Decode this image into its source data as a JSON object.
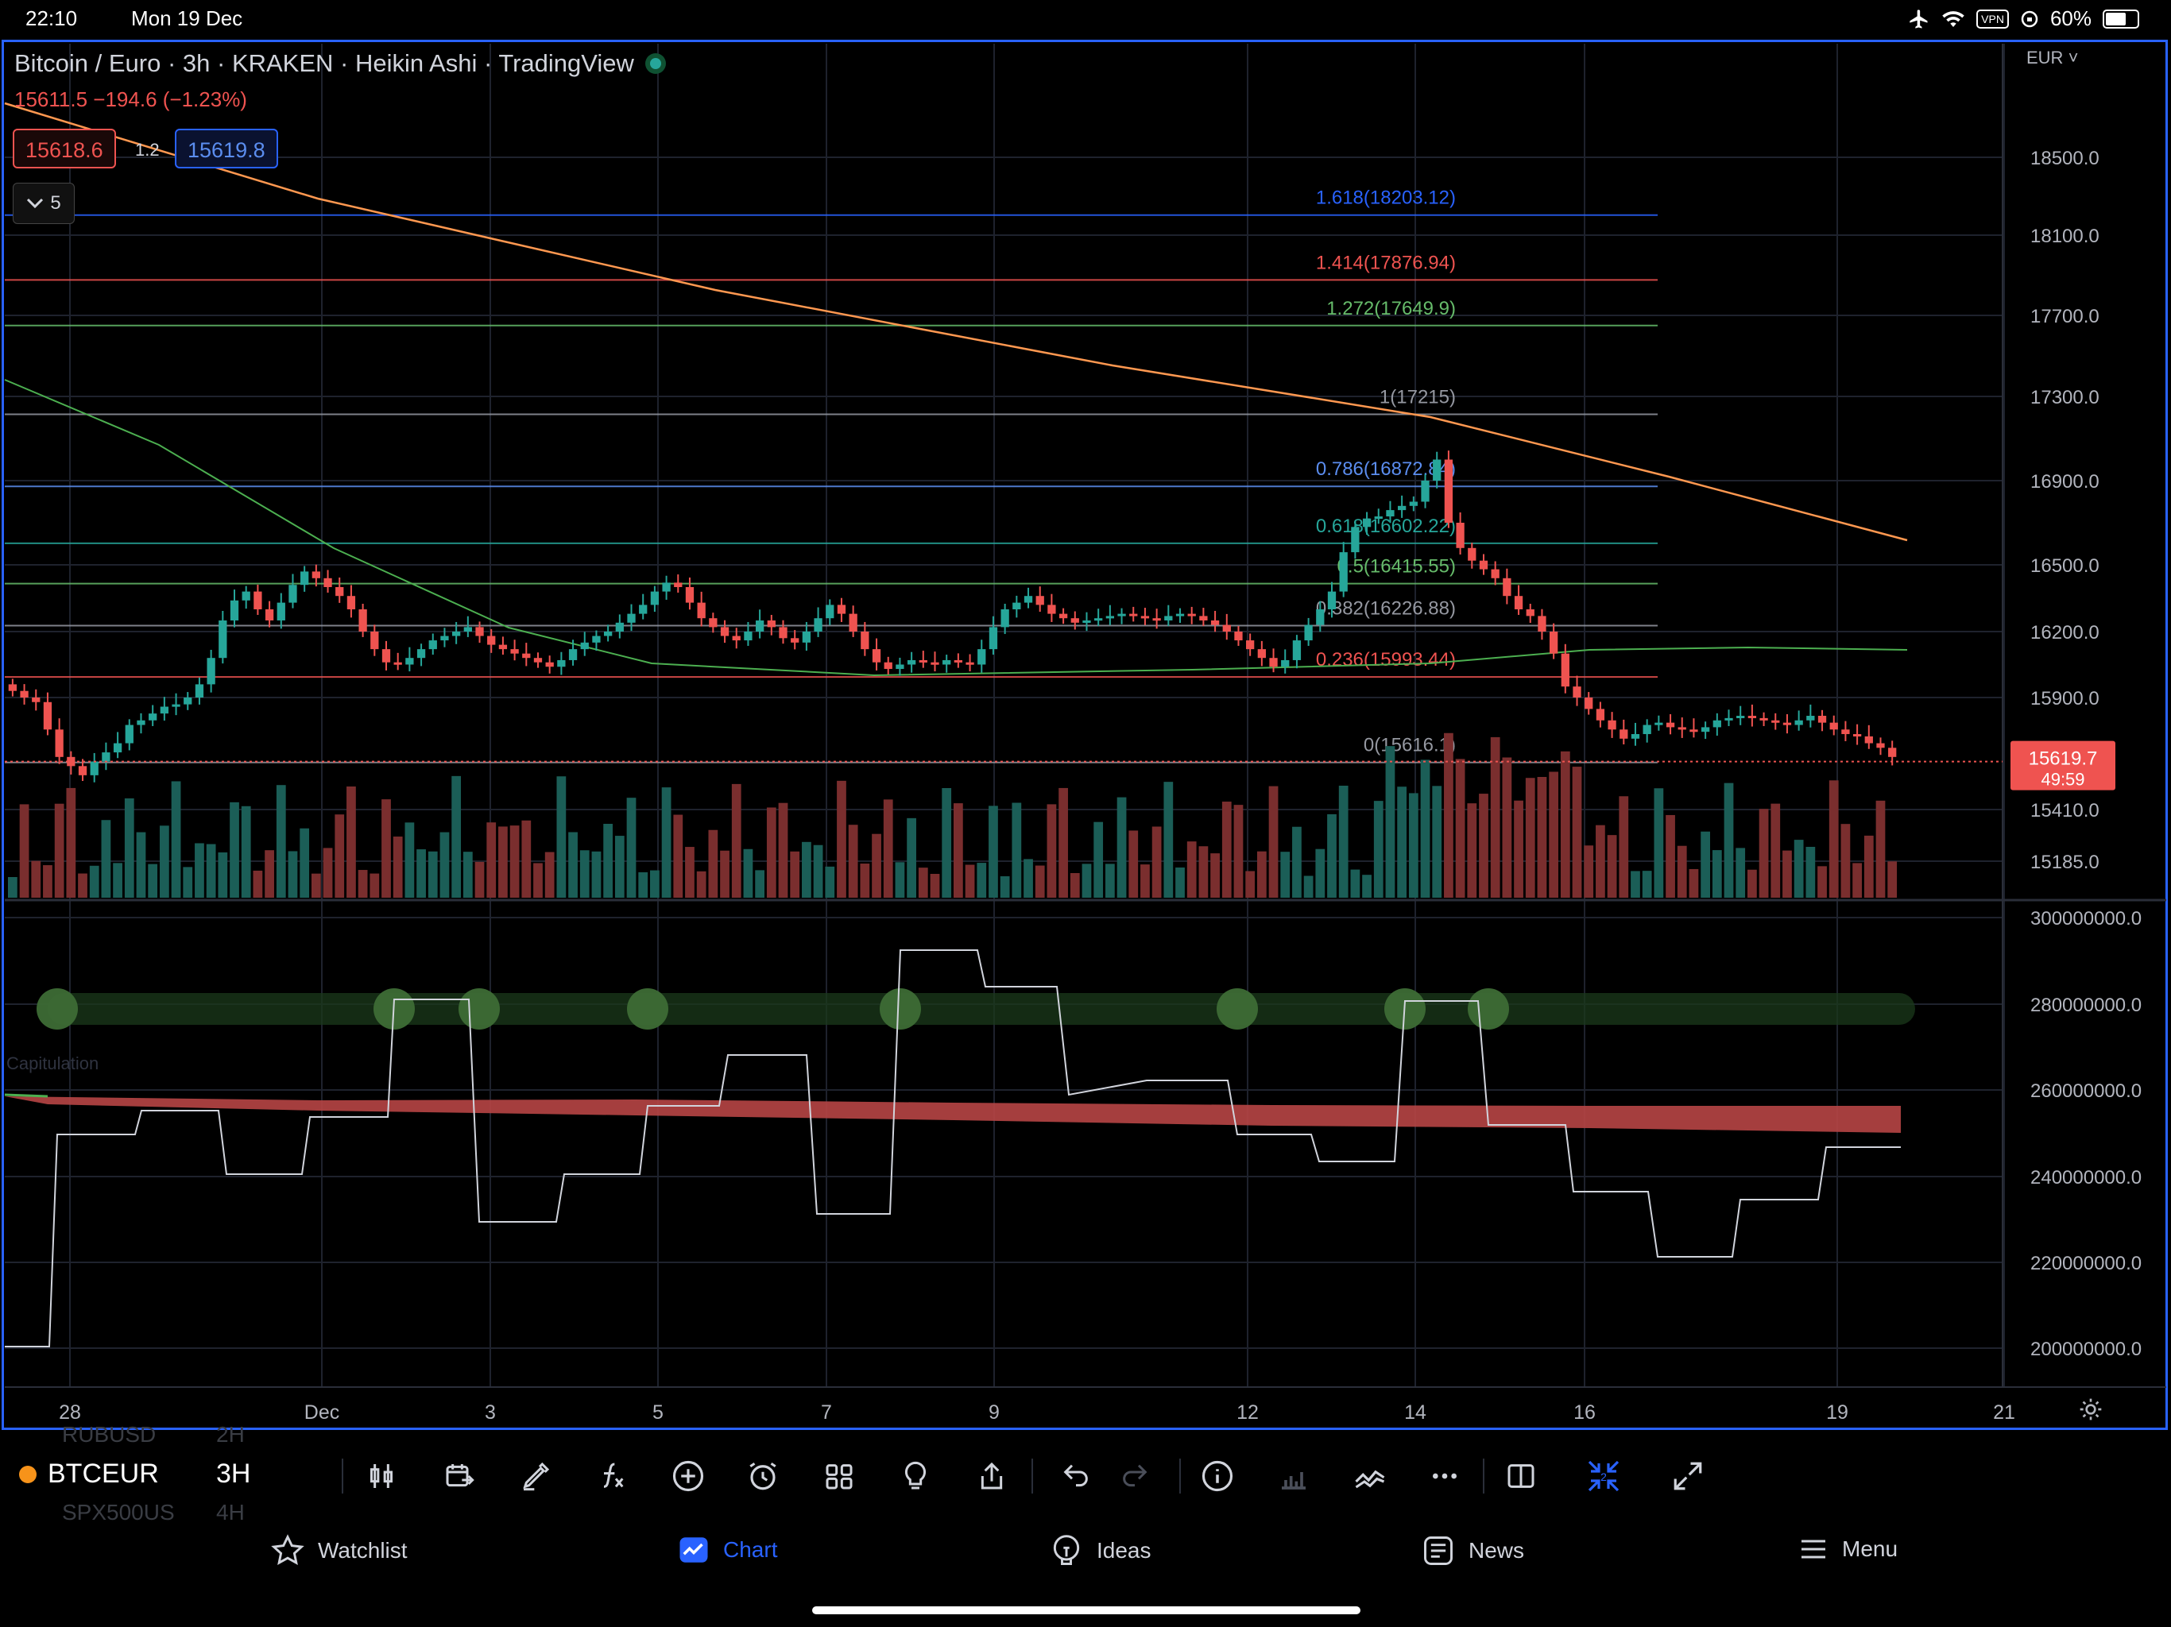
{
  "status_bar": {
    "time": "22:10",
    "date": "Mon 19 Dec",
    "vpn": "VPN",
    "battery": "60%"
  },
  "header": {
    "title": "Bitcoin / Euro · 3h · KRAKEN · Heikin Ashi · TradingView",
    "last_change": "15611.5 −194.6 (−1.23%)",
    "sell_price": "15618.6",
    "spread": "1.2",
    "buy_price": "15619.8",
    "indicators_count": "5",
    "currency": "EUR"
  },
  "chart_data": {
    "type": "candlestick",
    "symbol": "BTCEUR",
    "interval": "3H",
    "price_axis_labels": [
      "18500.0",
      "18100.0",
      "17700.0",
      "17300.0",
      "16900.0",
      "16500.0",
      "16200.0",
      "15900.0",
      "15410.0",
      "15185.0"
    ],
    "volume_axis_labels": [
      "300000000.0",
      "280000000.0",
      "260000000.0",
      "240000000.0",
      "220000000.0",
      "200000000.0"
    ],
    "x_axis_labels": [
      "28",
      "Dec",
      "3",
      "5",
      "7",
      "9",
      "12",
      "14",
      "16",
      "19",
      "21"
    ],
    "current_price": "15619.7",
    "countdown": "49:59",
    "fib_levels": [
      {
        "label": "1.618(18203.12)",
        "price": 18203.12,
        "color": "#2962ff"
      },
      {
        "label": "1.414(17876.94)",
        "price": 17876.94,
        "color": "#ef5350"
      },
      {
        "label": "1.272(17649.9)",
        "price": 17649.9,
        "color": "#66bb6a"
      },
      {
        "label": "1(17215)",
        "price": 17215,
        "color": "#9598a1"
      },
      {
        "label": "0.786(16872.84)",
        "price": 16872.84,
        "color": "#5b8def"
      },
      {
        "label": "0.618(16602.22)",
        "price": 16602.22,
        "color": "#26a69a"
      },
      {
        "label": "0.5(16415.55)",
        "price": 16415.55,
        "color": "#66bb6a"
      },
      {
        "label": "0.382(16226.88)",
        "price": 16226.88,
        "color": "#9598a1"
      },
      {
        "label": "0.236(15993.44)",
        "price": 15993.44,
        "color": "#ef5350"
      },
      {
        "label": "0(15616.1)",
        "price": 15616.1,
        "color": "#9598a1"
      }
    ],
    "panel_label": "Capitulation",
    "candles_close": [
      15930,
      15900,
      15880,
      15760,
      15640,
      15600,
      15560,
      15620,
      15660,
      15700,
      15780,
      15800,
      15830,
      15860,
      15870,
      15900,
      15960,
      16080,
      16250,
      16340,
      16380,
      16300,
      16250,
      16330,
      16410,
      16470,
      16440,
      16400,
      16360,
      16300,
      16200,
      16120,
      16060,
      16050,
      16080,
      16120,
      16160,
      16180,
      16200,
      16220,
      16180,
      16140,
      16120,
      16100,
      16080,
      16060,
      16040,
      16070,
      16120,
      16150,
      16180,
      16200,
      16240,
      16280,
      16320,
      16380,
      16420,
      16400,
      16330,
      16260,
      16220,
      16180,
      16160,
      16200,
      16250,
      16220,
      16170,
      16150,
      16200,
      16260,
      16320,
      16280,
      16200,
      16120,
      16060,
      16030,
      16050,
      16070,
      16060,
      16050,
      16070,
      16060,
      16050,
      16120,
      16220,
      16300,
      16330,
      16360,
      16320,
      16280,
      16260,
      16240,
      16250,
      16260,
      16270,
      16280,
      16270,
      16260,
      16250,
      16270,
      16280,
      16270,
      16250,
      16230,
      16200,
      16160,
      16120,
      16080,
      16040,
      16070,
      16160,
      16230,
      16300,
      16380,
      16560,
      16680,
      16720,
      16730,
      16760,
      16780,
      16800,
      16900,
      17000,
      16700,
      16580,
      16520,
      16480,
      16440,
      16360,
      16300,
      16270,
      16200,
      16100,
      15950,
      15900,
      15850,
      15800,
      15760,
      15720,
      15740,
      15780,
      15790,
      15770,
      15760,
      15750,
      15770,
      15800,
      15810,
      15820,
      15810,
      15800,
      15790,
      15780,
      15800,
      15820,
      15790,
      15760,
      15740,
      15730,
      15700,
      15680,
      15640
    ]
  },
  "toolbar": {
    "symbol": "BTCEUR",
    "interval": "3H",
    "ghost_symbol_top": "RUBUSD",
    "ghost_interval_top": "2H",
    "ghost_symbol_bottom": "SPX500US",
    "ghost_interval_bottom": "4H"
  },
  "tabs": [
    {
      "label": "Watchlist",
      "icon": "star-icon"
    },
    {
      "label": "Chart",
      "icon": "chart-icon"
    },
    {
      "label": "Ideas",
      "icon": "lightbulb-icon"
    },
    {
      "label": "News",
      "icon": "news-icon"
    },
    {
      "label": "Menu",
      "icon": "menu-icon"
    }
  ]
}
